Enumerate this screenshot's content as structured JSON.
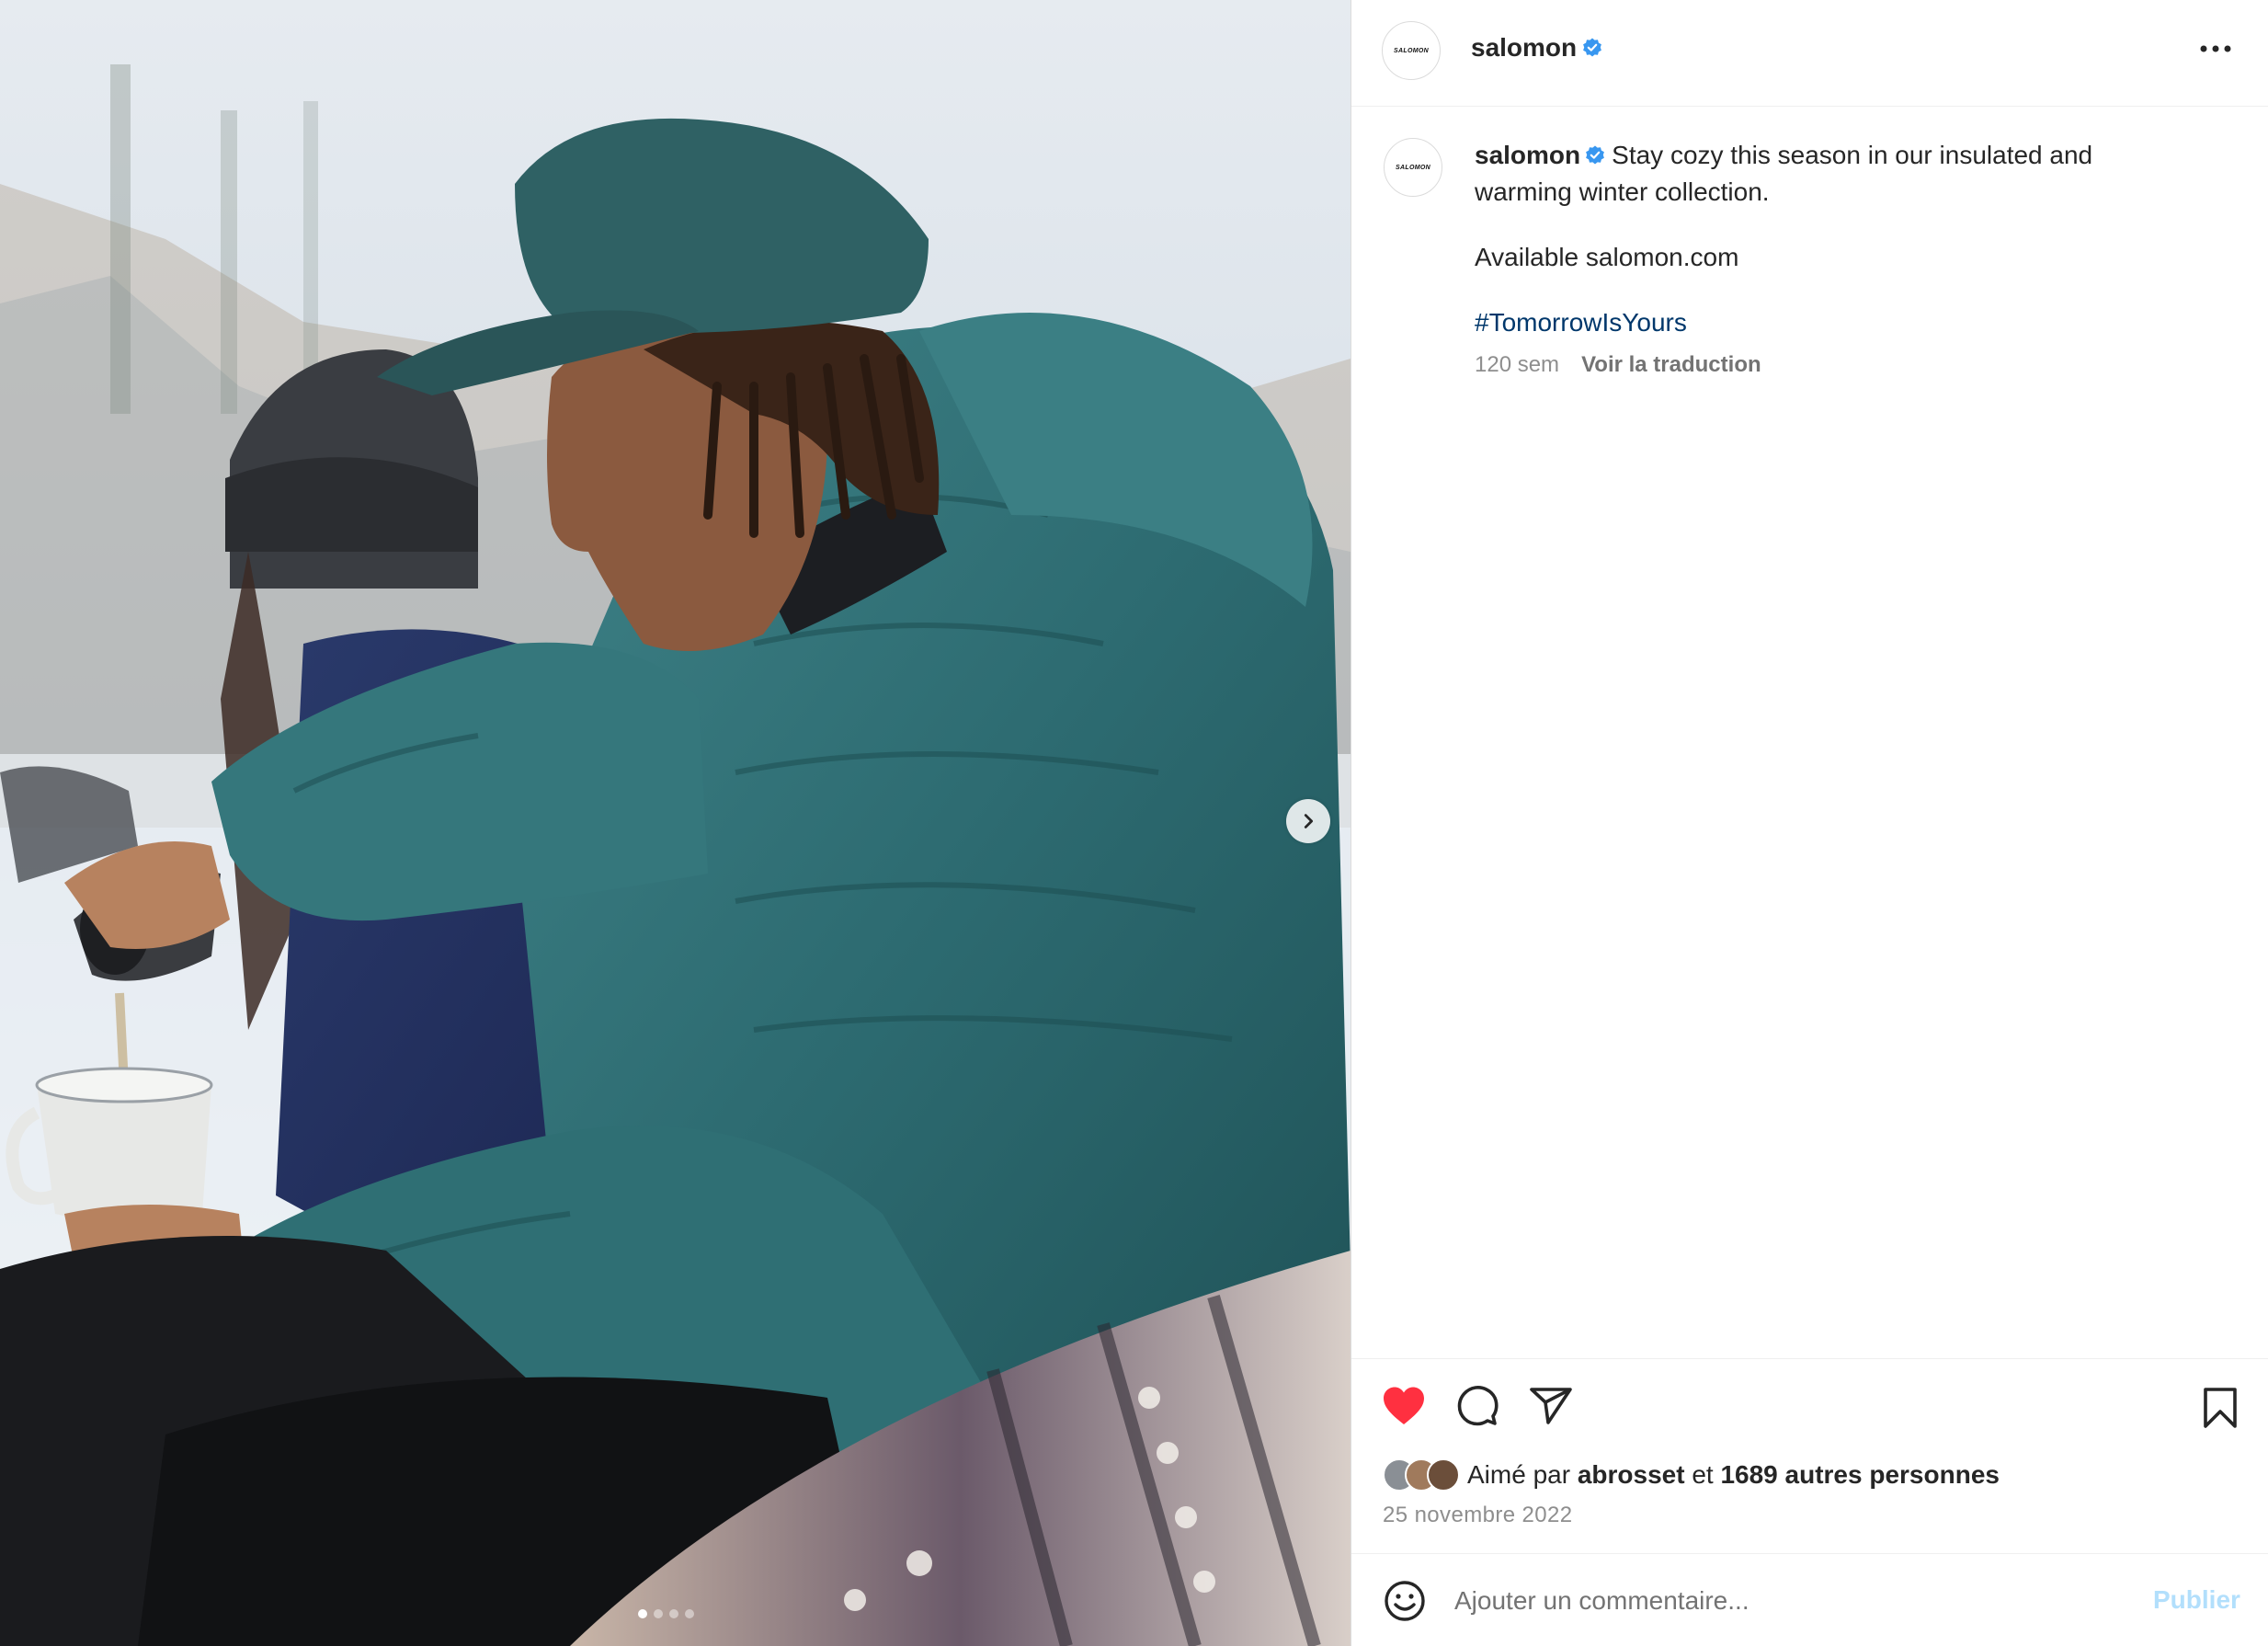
{
  "post": {
    "username": "salomon",
    "avatar_logo": "SALOMON",
    "caption": {
      "username": "salomon",
      "line1": "Stay cozy this season in our insulated and warming winter collection.",
      "line2": "Available salomon.com",
      "hashtag": "#TomorrowIsYours",
      "age": "120 sem",
      "translate": "Voir la traduction"
    },
    "likes": {
      "prefix": "Aimé par",
      "user": "abrosset",
      "joiner": "et",
      "others": "1689 autres personnes"
    },
    "date": "25 novembre 2022",
    "comment": {
      "placeholder": "Ajouter un commentaire...",
      "publish": "Publier"
    },
    "carousel": {
      "slide_count": 4,
      "active_index": 0
    }
  },
  "icons": {
    "header_more": "more-horizontal-icon",
    "verified": "verified-badge-icon",
    "like": "heart-filled-icon",
    "comment": "comment-icon",
    "share": "paper-plane-icon",
    "save": "bookmark-icon",
    "emoji": "smiley-icon",
    "next": "chevron-right-icon"
  },
  "colors": {
    "like_red": "#ff3040",
    "verified_blue": "#3897f0",
    "hashtag": "#00376b",
    "publish_disabled": "#b2dffc",
    "jacket_teal": "#2f6f74"
  }
}
